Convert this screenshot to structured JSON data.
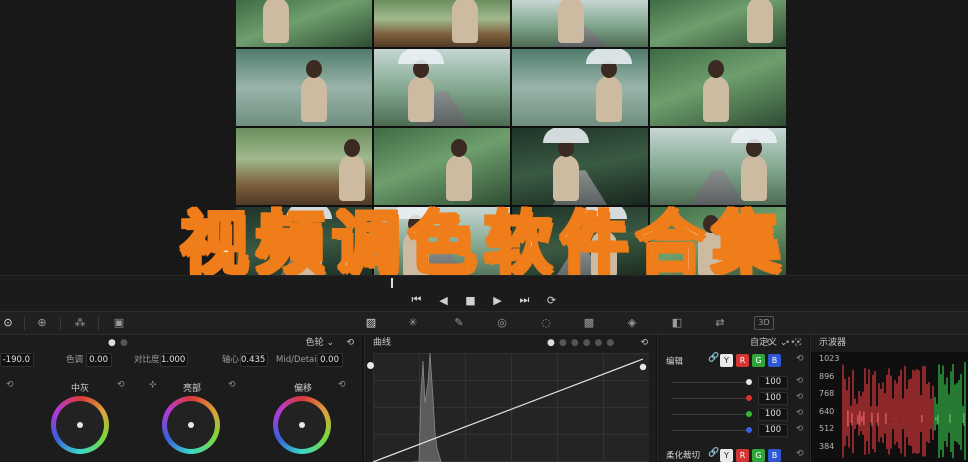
{
  "title_overlay": "视频调色软件合集",
  "viewer": {
    "thumbnails": [
      {
        "scene": "green"
      },
      {
        "scene": "bench"
      },
      {
        "scene": "mist"
      },
      {
        "scene": "green"
      },
      {
        "scene": "lake"
      },
      {
        "scene": "mist"
      },
      {
        "scene": "lake"
      },
      {
        "scene": "green"
      },
      {
        "scene": "bench"
      },
      {
        "scene": "green"
      },
      {
        "scene": "dark"
      },
      {
        "scene": "mist"
      },
      {
        "scene": "dark"
      },
      {
        "scene": "mist"
      },
      {
        "scene": "dark"
      },
      {
        "scene": "green"
      }
    ]
  },
  "transport": {
    "icons": [
      "skip-start-icon",
      "step-back-icon",
      "stop-icon",
      "play-icon",
      "skip-end-icon",
      "loop-icon"
    ],
    "glyphs": [
      "⏮",
      "◀",
      "■",
      "▶",
      "⏭",
      "⟳"
    ]
  },
  "toolbar": {
    "icons": [
      {
        "name": "camera-raw-icon",
        "glyph": "⊙"
      },
      {
        "name": "match-icon",
        "glyph": "⊕"
      },
      {
        "name": "color-match-icon",
        "glyph": "⁂"
      },
      {
        "name": "hdr-icon",
        "glyph": "▣"
      },
      {
        "name": "curves-icon",
        "glyph": "▨"
      },
      {
        "name": "warper-icon",
        "glyph": "✳"
      },
      {
        "name": "qualifier-icon",
        "glyph": "✎"
      },
      {
        "name": "window-icon",
        "glyph": "◎"
      },
      {
        "name": "tracker-icon",
        "glyph": "◌"
      },
      {
        "name": "magic-mask-icon",
        "glyph": "▩"
      },
      {
        "name": "blur-icon",
        "glyph": "◈"
      },
      {
        "name": "key-icon",
        "glyph": "◧"
      },
      {
        "name": "sizing-icon",
        "glyph": "⇄"
      },
      {
        "name": "3d-icon",
        "glyph": "3D"
      }
    ]
  },
  "wheels_panel": {
    "mode_label": "色轮",
    "params": {
      "temp_value": "-190.0",
      "tint_label": "色调",
      "tint_value": "0.00",
      "contrast_label": "对比度",
      "contrast_value": "1.000",
      "pivot_label": "轴心",
      "pivot_value": "0.435",
      "middetail_label": "Mid/Detail",
      "middetail_value": "0.00"
    },
    "wheels": [
      {
        "label": "中灰"
      },
      {
        "label": "亮部"
      },
      {
        "label": "偏移"
      }
    ]
  },
  "curves_panel": {
    "title": "曲线"
  },
  "edit_panel": {
    "title": "编辑",
    "mode": "自定义",
    "channels": [
      "Y",
      "R",
      "G",
      "B"
    ],
    "rows": [
      {
        "color": "#e6e6e6",
        "value": "100"
      },
      {
        "color": "#d93030",
        "value": "100"
      },
      {
        "color": "#34b634",
        "value": "100"
      },
      {
        "color": "#3a5fe0",
        "value": "100"
      }
    ],
    "soft_clip_label": "柔化裁切"
  },
  "scope_panel": {
    "title": "示波器",
    "axis": [
      "1023",
      "896",
      "768",
      "640",
      "512",
      "384"
    ],
    "colors": {
      "red": "#e0393c",
      "green": "#35c24a",
      "blue": "#3d6be0"
    }
  }
}
